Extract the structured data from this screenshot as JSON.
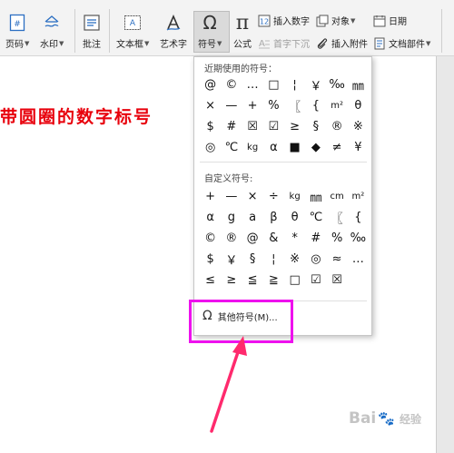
{
  "toolbar": {
    "page_number": "页码",
    "watermark": "水印",
    "comment": "批注",
    "textbox": "文本框",
    "art_text": "艺术字",
    "symbol": "符号",
    "formula": "公式",
    "insert_number": "插入数字",
    "object": "对象",
    "date": "日期",
    "first_letter_sink": "首字下沉",
    "insert_attachment": "插入附件",
    "doc_parts": "文档部件"
  },
  "document": {
    "title_fragment": "带圆圈的数字标号"
  },
  "dropdown": {
    "recent_title": "近期使用的符号：",
    "recent_symbols": [
      "@",
      "©",
      "…",
      "□",
      "¦",
      "￥",
      "‰",
      "㎜",
      "×",
      "—",
      "+",
      "%",
      "〖",
      "{",
      "m²",
      "θ",
      "$",
      "#",
      "☒",
      "☑",
      "≥",
      "§",
      "®",
      "※",
      "◎",
      "℃",
      "kg",
      "α",
      "■",
      "◆",
      "≠",
      "¥"
    ],
    "custom_title": "自定义符号:",
    "custom_symbols": [
      "+",
      "—",
      "×",
      "÷",
      "kg",
      "㎜",
      "cm",
      "m²",
      "α",
      "g",
      "a",
      "β",
      "θ",
      "℃",
      "〖",
      "{",
      "©",
      "®",
      "@",
      "&",
      "*",
      "#",
      "%",
      "‰",
      "$",
      "￥",
      "§",
      "¦",
      "※",
      "◎",
      "≈",
      "…",
      "≤",
      "≥",
      "≦",
      "≧",
      "□",
      "☑",
      "☒"
    ],
    "more_symbols": "其他符号(M)..."
  },
  "watermark": {
    "brand": "Bai",
    "brand2": "经验"
  }
}
